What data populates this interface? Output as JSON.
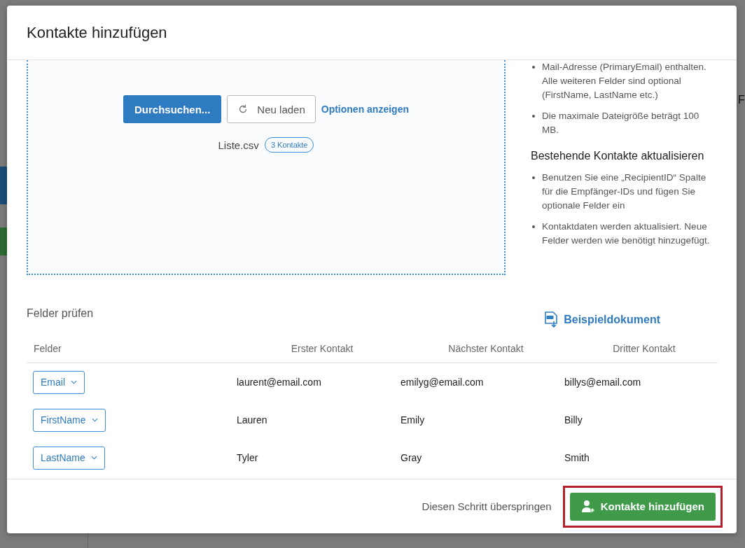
{
  "backdrop": {
    "edge_text": "F"
  },
  "dialog": {
    "title": "Kontakte hinzufügen",
    "upload": {
      "browse_button": "Durchsuchen...",
      "reload_button": "Neu laden",
      "options_link": "Optionen anzeigen",
      "file_name": "Liste.csv",
      "file_badge": "3 Kontakte"
    },
    "help": {
      "new_bullets": [
        "Mail-Adresse (PrimaryEmail) enthalten. Alle weiteren Felder sind optional (FirstName, LastName etc.)",
        "Die maximale Dateigröße beträgt 100 MB."
      ],
      "update_heading": "Bestehende Kontakte aktualisieren",
      "update_bullets": [
        "Benutzen Sie eine „RecipientID“ Spalte für die Empfänger-IDs und fügen Sie optionale Felder ein",
        "Kontaktdaten werden aktualisiert. Neue Felder werden wie benötigt hinzugefügt."
      ],
      "sample_link": "Beispieldokument"
    },
    "review": {
      "title": "Felder prüfen",
      "columns": [
        "Felder",
        "Erster Kontakt",
        "Nächster Kontakt",
        "Dritter Kontakt"
      ],
      "rows": [
        {
          "field": "Email",
          "values": [
            "laurent@email.com",
            "emilyg@email.com",
            "billys@email.com"
          ]
        },
        {
          "field": "FirstName",
          "values": [
            "Lauren",
            "Emily",
            "Billy"
          ]
        },
        {
          "field": "LastName",
          "values": [
            "Tyler",
            "Gray",
            "Smith"
          ]
        }
      ]
    },
    "footer": {
      "skip_link": "Diesen Schritt überspringen",
      "add_button": "Kontakte hinzufügen",
      "add_button_highlighted": true
    }
  }
}
